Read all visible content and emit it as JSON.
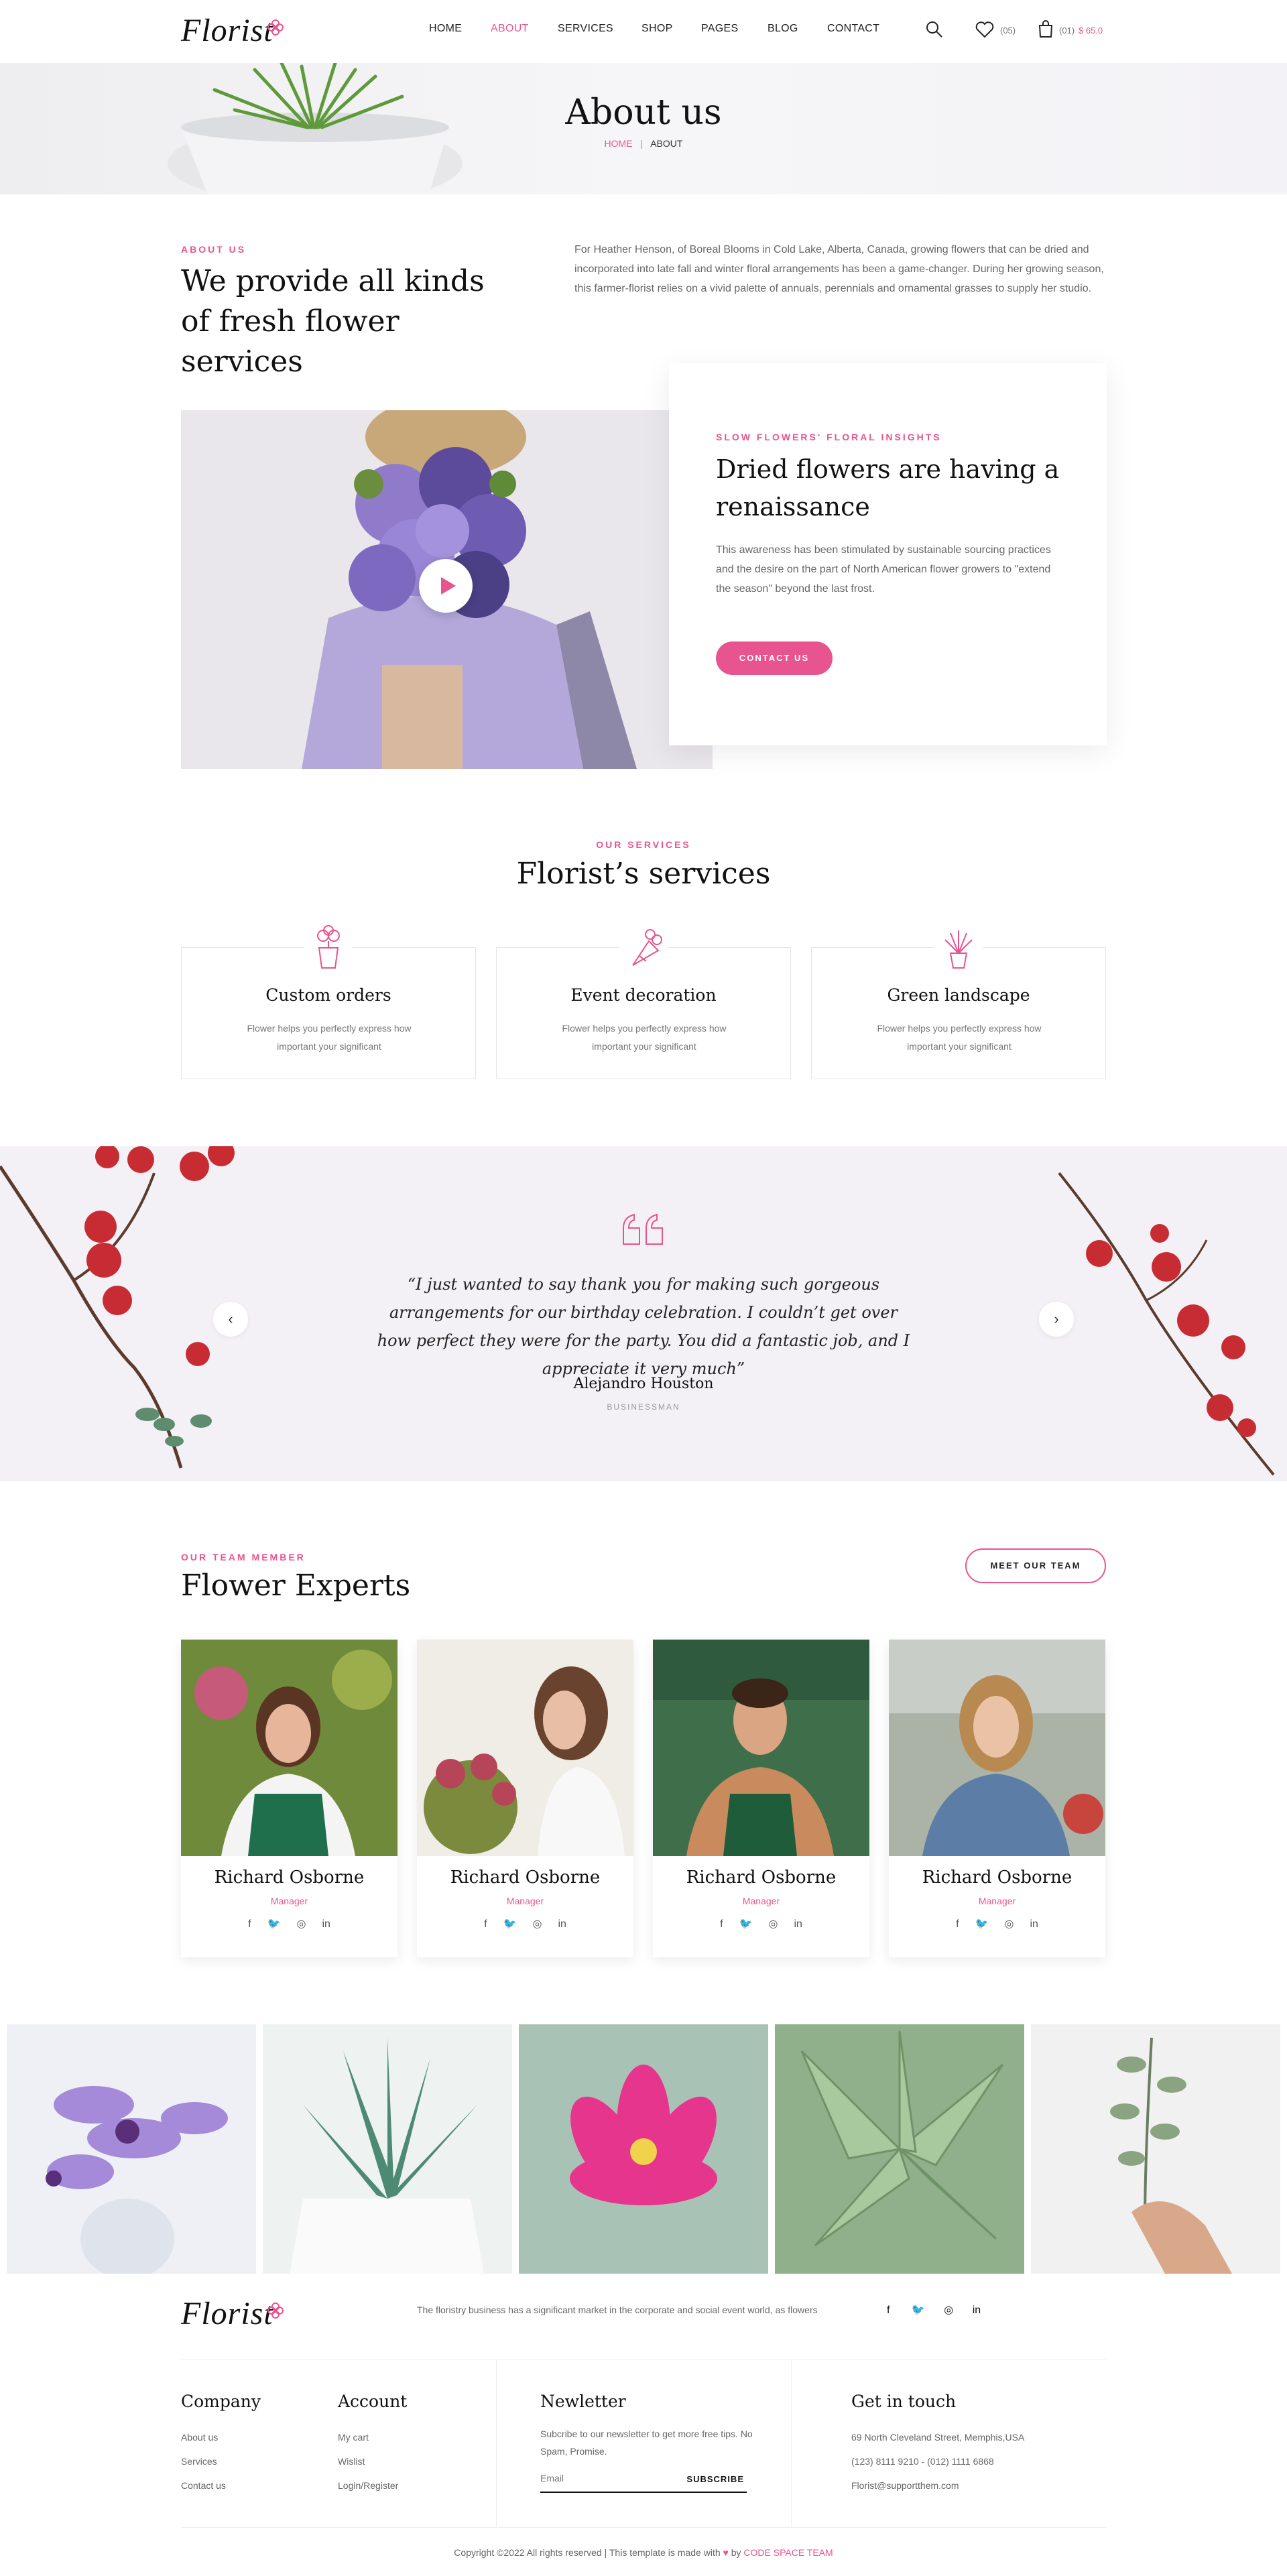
{
  "header": {
    "logo": "Florist",
    "nav": [
      "HOME",
      "ABOUT",
      "SERVICES",
      "SHOP",
      "PAGES",
      "BLOG",
      "CONTACT"
    ],
    "active_nav": "ABOUT",
    "wishlist_count": "(05)",
    "cart_count": "(01)",
    "cart_total": "$ 65.0",
    "accent": "#e8548f"
  },
  "hero": {
    "title": "About us",
    "breadcrumb_home": "HOME",
    "breadcrumb_sep": "|",
    "breadcrumb_current": "ABOUT"
  },
  "about": {
    "eyebrow": "ABOUT US",
    "heading": "We provide all kinds of fresh flower services",
    "paragraph": "For Heather Henson, of Boreal Blooms in Cold Lake, Alberta, Canada, growing flowers that can be dried and incorporated into late fall and winter floral arrangements has been a game-changer. During her growing season, this farmer-florist relies on a vivid palette of annuals, perennials and ornamental grasses to supply her studio.",
    "card_eyebrow": "SLOW FLOWERS' FLORAL INSIGHTS",
    "card_title": "Dried flowers are having a renaissance",
    "card_text": "This awareness has been stimulated by sustainable sourcing practices and the desire on the part of North American flower growers to \"extend the season\" beyond the last frost.",
    "card_button": "CONTACT US"
  },
  "services": {
    "eyebrow": "OUR SERVICES",
    "title": "Florist’s services",
    "items": [
      {
        "icon": "flower-pot-icon",
        "title": "Custom orders",
        "text": "Flower helps you perfectly express how important your significant"
      },
      {
        "icon": "bouquet-icon",
        "title": "Event decoration",
        "text": "Flower helps you perfectly express how important your significant"
      },
      {
        "icon": "plant-icon",
        "title": "Green landscape",
        "text": "Flower helps you perfectly express how important your significant"
      }
    ]
  },
  "testimonial": {
    "quote": "“I just wanted to say thank you for making such gorgeous arrangements for our birthday celebration. I couldn’t get over how perfect they were for the party. You did a fantastic job, and I appreciate it very much”",
    "author": "Alejandro Houston",
    "role": "BUSINESSMAN"
  },
  "team": {
    "eyebrow": "OUR TEAM MEMBER",
    "title": "Flower Experts",
    "button": "MEET OUR TEAM",
    "members": [
      {
        "name": "Richard Osborne",
        "role": "Manager"
      },
      {
        "name": "Richard Osborne",
        "role": "Manager"
      },
      {
        "name": "Richard Osborne",
        "role": "Manager"
      },
      {
        "name": "Richard Osborne",
        "role": "Manager"
      }
    ]
  },
  "footer": {
    "logo": "Florist",
    "tagline": "The floristry business has a significant market in the corporate and social event world, as flowers",
    "company_title": "Company",
    "company_links": [
      "About us",
      "Services",
      "Contact us"
    ],
    "account_title": "Account",
    "account_links": [
      "My cart",
      "Wislist",
      "Login/Register"
    ],
    "newsletter_title": "Newletter",
    "newsletter_text": "Subcribe to our newsletter to get more free tips. No Spam, Promise.",
    "email_placeholder": "Email",
    "subscribe": "SUBSCRIBE",
    "contact_title": "Get in touch",
    "address": "69 North Cleveland Street, Memphis,USA",
    "phone": "(123) 8111 9210 - (012) 1111 6868",
    "email": "Florist@supportthem.com",
    "copyright_pre": "Copyright ©2022 All rights reserved | This template is made with",
    "copyright_by": "by",
    "copyright_team": "CODE SPACE TEAM"
  }
}
